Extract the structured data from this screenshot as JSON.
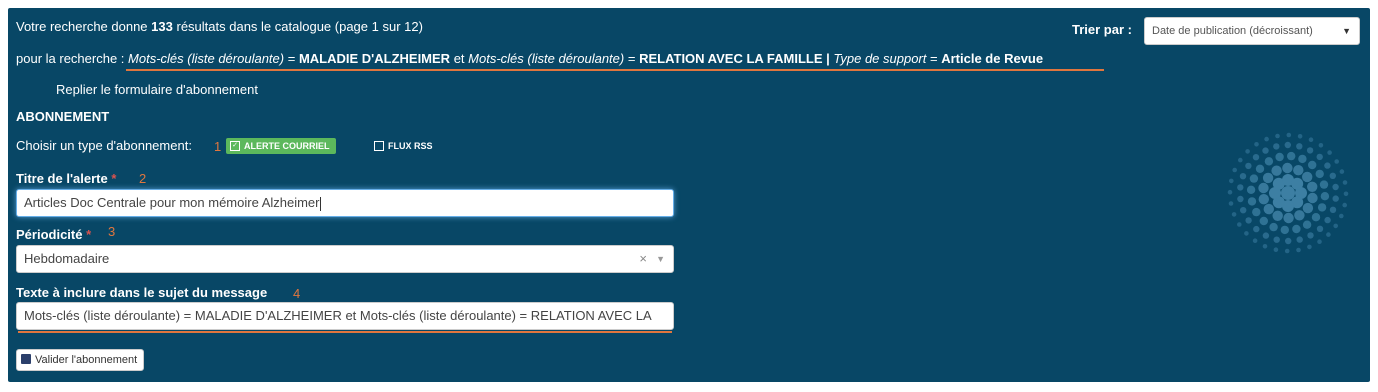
{
  "header": {
    "results_prefix": "Votre recherche donne",
    "results_count": "133",
    "results_suffix": "résultats dans le catalogue (page 1 sur 12)",
    "sort_label": "Trier par :",
    "sort_value": "Date de publication (décroissant)"
  },
  "query": {
    "prefix": "pour la recherche :",
    "field1": "Mots-clés (liste déroulante)",
    "eq1": "=",
    "value1": "MALADIE D'ALZHEIMER",
    "and": "et",
    "field2": "Mots-clés (liste déroulante)",
    "eq2": "=",
    "value2": "RELATION AVEC LA FAMILLE |",
    "field3": "Type de support",
    "eq3": "=",
    "value3": "Article de Revue"
  },
  "collapse_link": "Replier le formulaire d'abonnement",
  "subscription": {
    "heading": "ABONNEMENT",
    "type_label": "Choisir un type d'abonnement:",
    "step1": "1",
    "email_option": "ALERTE COURRIEL",
    "email_checked": true,
    "rss_option": "FLUX RSS",
    "title_label": "Titre de l'alerte",
    "required_mark": "*",
    "step2": "2",
    "title_value": "Articles Doc Centrale pour mon mémoire Alzheimer",
    "period_label": "Périodicité",
    "step3": "3",
    "period_value": "Hebdomadaire",
    "subject_label": "Texte à inclure dans le sujet du message",
    "step4": "4",
    "subject_value": "Mots-clés (liste déroulante) = MALADIE D'ALZHEIMER et Mots-clés (liste déroulante) = RELATION AVEC LA",
    "submit_label": "Valider l'abonnement"
  },
  "colors": {
    "panel_bg": "#084766",
    "accent_orange": "#e0763e",
    "badge_green": "#5cb85c",
    "logo_blue": "#3d7fa3"
  },
  "icons": {
    "logo": "dotted-circle-logo",
    "save": "floppy-disk-icon"
  }
}
